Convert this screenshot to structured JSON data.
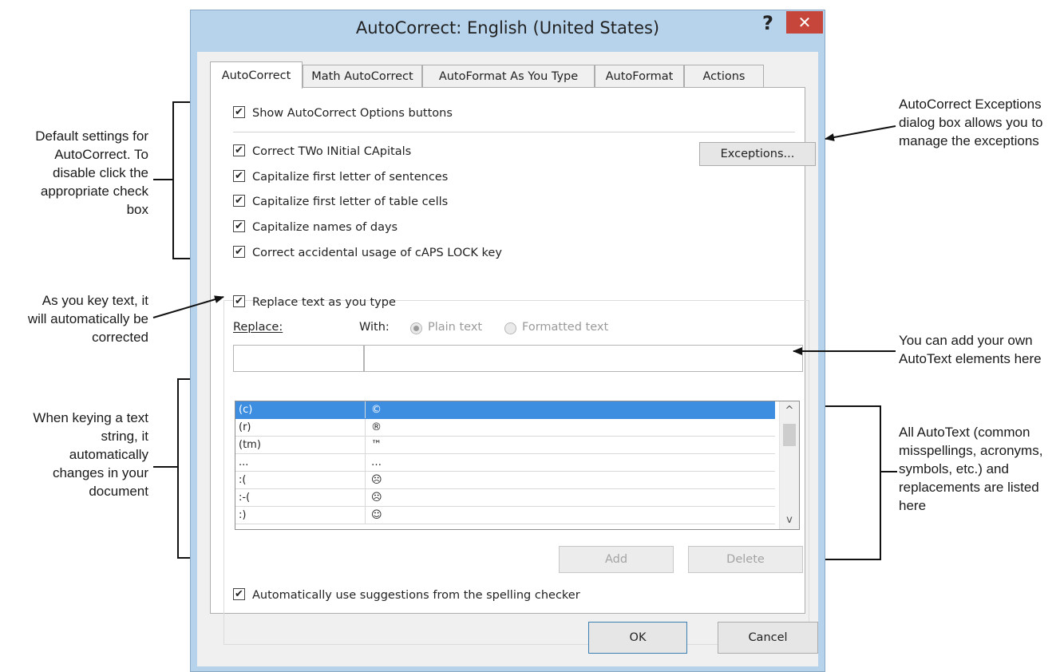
{
  "dialog": {
    "title": "AutoCorrect: English (United States)",
    "help_label": "?",
    "close_label": "✕",
    "tabs": [
      "AutoCorrect",
      "Math AutoCorrect",
      "AutoFormat As You Type",
      "AutoFormat",
      "Actions"
    ],
    "show_options_label": "Show AutoCorrect Options buttons",
    "options": [
      "Correct TWo INitial CApitals",
      "Capitalize first letter of sentences",
      "Capitalize first letter of table cells",
      "Capitalize names of days",
      "Correct accidental usage of cAPS LOCK key"
    ],
    "exceptions_label": "Exceptions...",
    "replace_as_type_label": "Replace text as you type",
    "replace_label": "Replace:",
    "with_label": "With:",
    "plain_text_label": "Plain text",
    "formatted_text_label": "Formatted text",
    "replace_value": "",
    "with_value": "",
    "entries": [
      {
        "from": "(c)",
        "to": "©"
      },
      {
        "from": "(r)",
        "to": "®"
      },
      {
        "from": "(tm)",
        "to": "™"
      },
      {
        "from": "...",
        "to": "…"
      },
      {
        "from": ":(",
        "to": "☹"
      },
      {
        "from": ":-(",
        "to": "☹"
      },
      {
        "from": ":)",
        "to": "☺"
      }
    ],
    "add_label": "Add",
    "delete_label": "Delete",
    "suggestions_label": "Automatically use suggestions from the spelling checker",
    "ok_label": "OK",
    "cancel_label": "Cancel",
    "check_mark": "✔",
    "scroll_up": "^",
    "scroll_down": "v"
  },
  "callouts": {
    "default_settings": [
      "Default settings for",
      "AutoCorrect. To",
      "disable click the",
      "appropriate check",
      "box"
    ],
    "as_you_key": [
      "As you key text, it",
      "will automatically be",
      "corrected"
    ],
    "when_keying": [
      "When keying a text",
      "string, it",
      "automatically",
      "changes in your",
      "document"
    ],
    "exceptions_dialog": [
      "AutoCorrect Exceptions",
      "dialog box allows you to",
      "manage the exceptions"
    ],
    "add_own": [
      "You can add your own",
      "AutoText elements here"
    ],
    "all_autotext": [
      "All AutoText (common",
      "misspellings, acronyms,",
      "symbols, etc.) and",
      "replacements are listed",
      "here"
    ]
  }
}
